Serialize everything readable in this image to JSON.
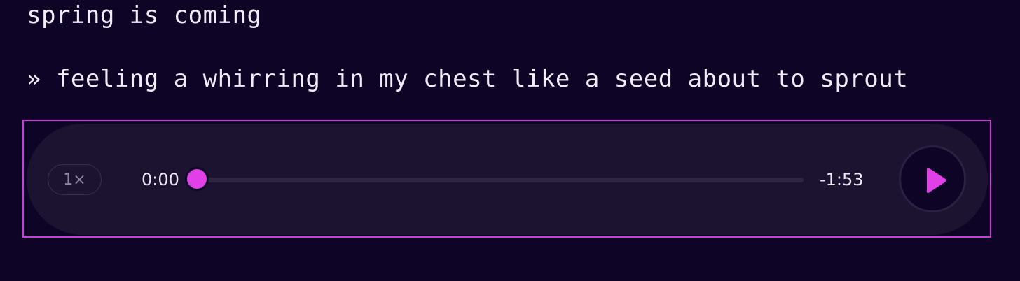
{
  "post": {
    "line1": "spring is coming",
    "line2": "» feeling a whirring in my chest like a seed about to sprout"
  },
  "player": {
    "speed_label": "1×",
    "current_time": "0:00",
    "remaining_time": "-1:53",
    "progress": 0,
    "play_icon": "play-icon",
    "colors": {
      "background": "#0d0426",
      "player_bg": "#1c1331",
      "accent": "#e040e6",
      "frame": "#c73fd6"
    }
  }
}
